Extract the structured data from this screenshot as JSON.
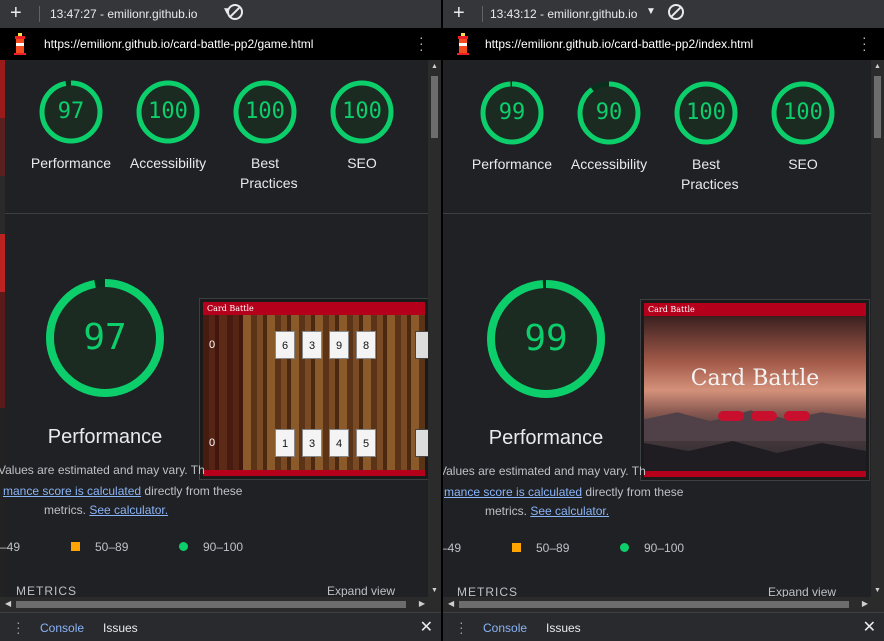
{
  "left": {
    "tab_title": "13:47:27 - emilionr.github.io",
    "url": "https://emilionr.github.io/card-battle-pp2/game.html",
    "scores": [
      {
        "value": "97",
        "label": "Performance"
      },
      {
        "value": "100",
        "label": "Accessibility"
      },
      {
        "value": "100",
        "label": "Best Practices"
      },
      {
        "value": "100",
        "label": "SEO"
      }
    ],
    "main_score": "97",
    "main_label": "Performance",
    "screenshot": {
      "header": "Card Battle",
      "top_score": "0",
      "bottom_score": "0",
      "top_cards": [
        "6",
        "3",
        "9",
        "8"
      ],
      "bottom_cards": [
        "1",
        "3",
        "4",
        "5"
      ]
    }
  },
  "right": {
    "tab_title": "13:43:12 - emilionr.github.io",
    "url": "https://emilionr.github.io/card-battle-pp2/index.html",
    "scores": [
      {
        "value": "99",
        "label": "Performance"
      },
      {
        "value": "90",
        "label": "Accessibility"
      },
      {
        "value": "100",
        "label": "Best Practices"
      },
      {
        "value": "100",
        "label": "SEO"
      }
    ],
    "main_score": "99",
    "main_label": "Performance",
    "screenshot": {
      "header": "Card Battle",
      "hero_title": "Card Battle"
    }
  },
  "common": {
    "desc_line1": "Values are estimated and may vary. Th",
    "desc_line2_link": "mance score is calculated",
    "desc_line2_rest": " directly from these",
    "desc_line3_prefix": "metrics. ",
    "desc_line3_link": "See calculator.",
    "legend_red": "–49",
    "legend_orange": "50–89",
    "legend_green": "90–100",
    "metrics_label": "METRICS",
    "expand_label": "Expand view",
    "console_tab": "Console",
    "issues_tab": "Issues"
  },
  "colors": {
    "pass": "#0cce6b",
    "average": "#ffa400",
    "accent_red": "#b5001c"
  },
  "gauge_fill": {
    "left": [
      0.97,
      1.0,
      1.0,
      1.0,
      0.97
    ],
    "right": [
      0.99,
      0.9,
      1.0,
      1.0,
      0.99
    ]
  }
}
